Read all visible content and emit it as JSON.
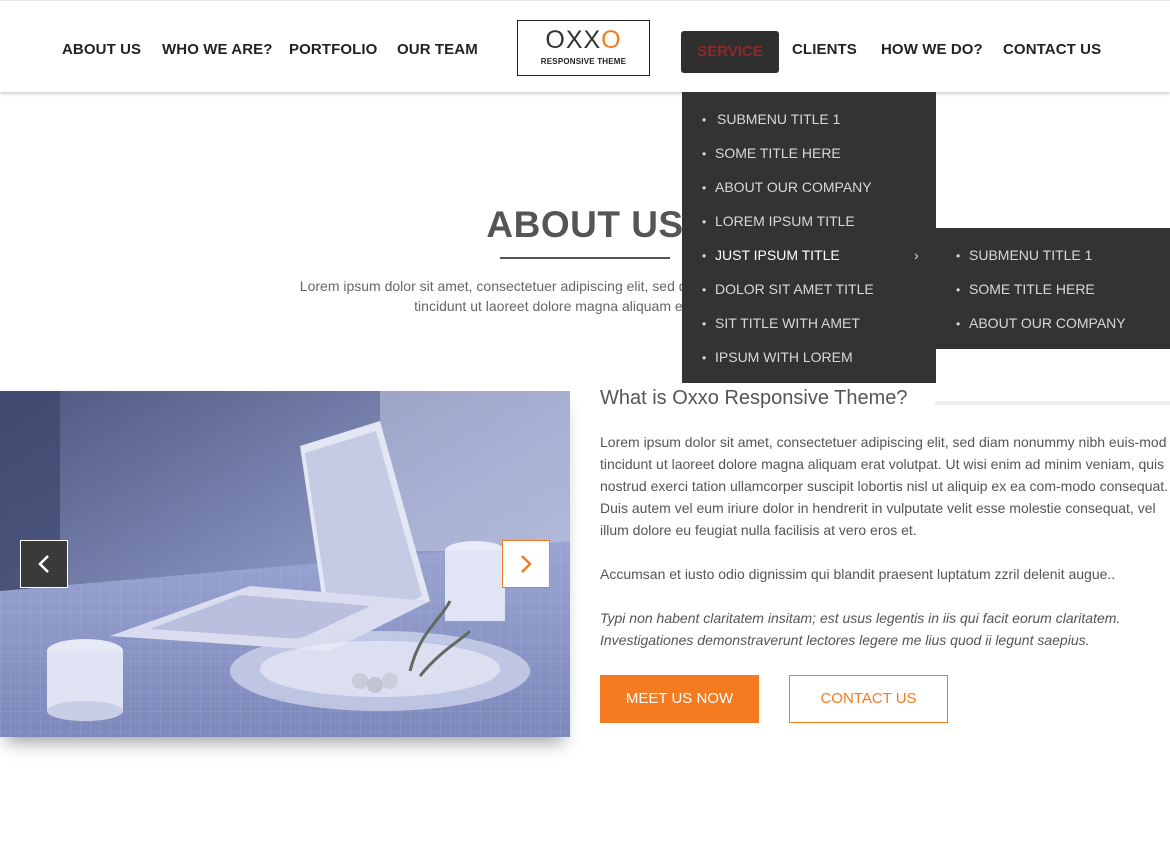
{
  "nav": {
    "left": [
      "ABOUT US",
      "WHO WE ARE?",
      "PORTFOLIO",
      "OUR TEAM"
    ],
    "active": "SERVICE",
    "right": [
      "CLIENTS",
      "HOW WE DO?",
      "CONTACT US"
    ]
  },
  "logo": {
    "word_main": "OXX",
    "word_accent": "O",
    "tagline": "RESPONSIVE THEME"
  },
  "dropdown": {
    "items": [
      "SUBMENU TITLE 1",
      "SOME TITLE HERE",
      "ABOUT OUR COMPANY",
      "LOREM IPSUM TITLE",
      "JUST IPSUM TITLE",
      "DOLOR SIT AMET TITLE",
      "SIT TITLE WITH AMET",
      "IPSUM WITH LOREM"
    ],
    "bullet": "•",
    "arrow": "›"
  },
  "submenu": {
    "items": [
      "SUBMENU TITLE 1",
      "SOME TITLE HERE",
      "ABOUT OUR COMPANY"
    ]
  },
  "about": {
    "title": "ABOUT US",
    "desc": "Lorem ipsum dolor sit amet, consectetuer adipiscing elit, sed diam nonummy nibh euis- mod tincidunt ut laoreet dolore magna aliquam erat volutpat."
  },
  "feature": {
    "question": "What is Oxxo Responsive Theme?",
    "p1": "Lorem ipsum dolor sit amet, consectetuer adipiscing elit, sed diam nonummy nibh euis-mod tincidunt ut laoreet dolore magna aliquam erat volutpat. Ut wisi enim ad minim veniam, quis nostrud exerci tation ullamcorper suscipit lobortis nisl ut aliquip ex ea com-modo consequat. Duis autem vel eum iriure dolor in hendrerit in vulputate velit esse molestie consequat, vel illum dolore eu feugiat nulla facilisis at vero eros et.",
    "p2": " Accumsan et iusto odio dignissim qui blandit praesent luptatum zzril delenit augue..",
    "p3": "Typi non habent claritatem insitam; est usus legentis in iis qui facit eorum claritatem. Investigationes demonstraverunt lectores legere me lius quod ii legunt saepius.",
    "btn_meet": "MEET US NOW",
    "btn_contact": "CONTACT US"
  },
  "colors": {
    "accent": "#f47b20",
    "menu_bg": "#333333",
    "text": "#555555"
  },
  "icons": {
    "prev": "chevron-left-icon",
    "next": "chevron-right-icon"
  }
}
